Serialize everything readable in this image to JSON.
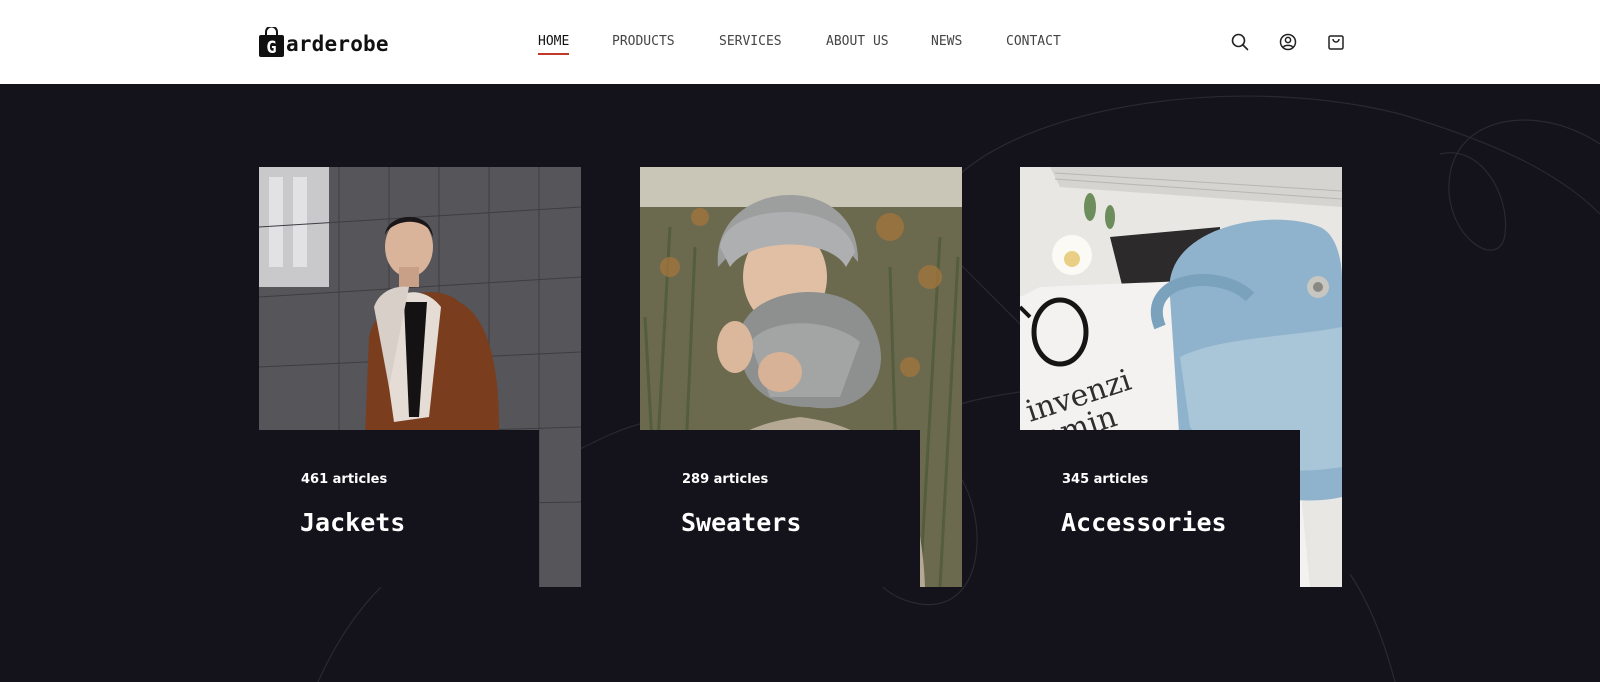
{
  "brand": {
    "logo_letter": "G",
    "logo_text": "arderobe"
  },
  "nav": {
    "items": [
      {
        "label": "HOME",
        "active": true
      },
      {
        "label": "PRODUCTS",
        "active": false
      },
      {
        "label": "SERVICES",
        "active": false
      },
      {
        "label": "ABOUT US",
        "active": false
      },
      {
        "label": "NEWS",
        "active": false
      },
      {
        "label": "CONTACT",
        "active": false
      }
    ],
    "active_underline_color": "#c0392b"
  },
  "header_icons": [
    "search-icon",
    "user-icon",
    "shopping-bag-icon"
  ],
  "categories": [
    {
      "count": "461 articles",
      "title": "Jackets",
      "image": "man-in-brown-shearling-jacket"
    },
    {
      "count": "289 articles",
      "title": "Sweaters",
      "image": "woman-in-knit-hat-and-scarf"
    },
    {
      "count": "345 articles",
      "title": "Accessories",
      "image": "light-blue-handbag-and-glasses"
    }
  ],
  "colors": {
    "background": "#14121a",
    "header": "#ffffff",
    "text_light": "#ffffff"
  }
}
